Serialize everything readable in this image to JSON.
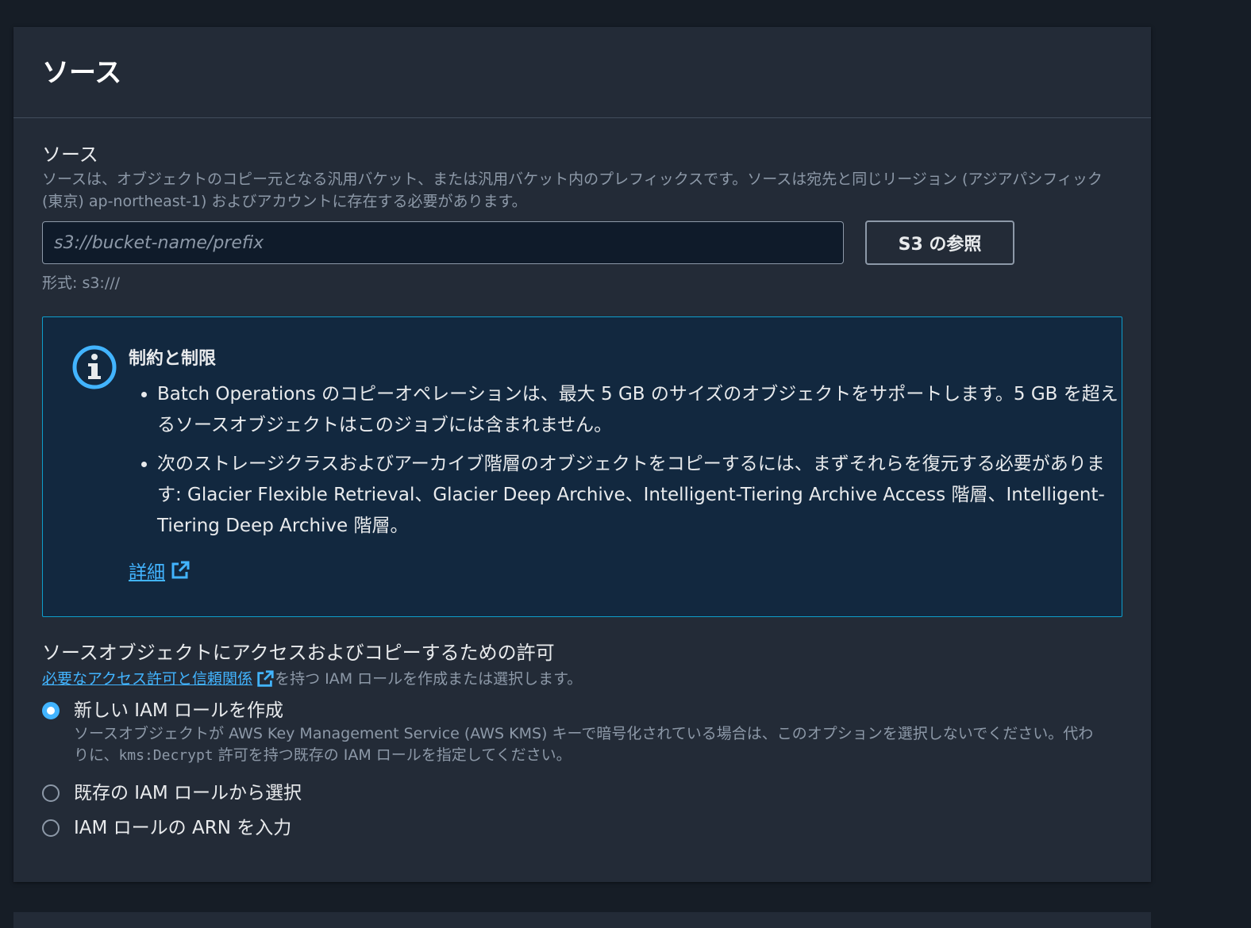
{
  "panel": {
    "title": "ソース"
  },
  "source_field": {
    "label": "ソース",
    "description": "ソースは、オブジェクトのコピー元となる汎用バケット、または汎用バケット内のプレフィックスです。ソースは宛先と同じリージョン (アジアパシフィック (東京) ap-northeast-1) およびアカウントに存在する必要があります。",
    "placeholder": "s3://bucket-name/prefix",
    "value": "",
    "browse_button": "S3 の参照",
    "constraint": "形式: s3:///"
  },
  "alert": {
    "title": "制約と制限",
    "items": [
      "Batch Operations のコピーオペレーションは、最大 5 GB のサイズのオブジェクトをサポートします。5 GB を超えるソースオブジェクトはこのジョブには含まれません。",
      "次のストレージクラスおよびアーカイブ階層のオブジェクトをコピーするには、まずそれらを復元する必要があります: Glacier Flexible Retrieval、Glacier Deep Archive、Intelligent-Tiering Archive Access 階層、Intelligent-Tiering Deep Archive 階層。"
    ],
    "link": "詳細",
    "icon": "info-icon",
    "border_color": "#0e9ecb",
    "bg_color": "#12283f"
  },
  "permissions": {
    "label": "ソースオブジェクトにアクセスおよびコピーするための許可",
    "link": "必要なアクセス許可と信頼関係",
    "desc_suffix": "を持つ IAM ロールを作成または選択します。",
    "options": [
      {
        "label": "新しい IAM ロールを作成",
        "checked": true,
        "desc_before": "ソースオブジェクトが AWS Key Management Service (AWS KMS) キーで暗号化されている場合は、このオプションを選択しないでください。代わりに、",
        "desc_code": "kms:Decrypt",
        "desc_after": " 許可を持つ既存の IAM ロールを指定してください。"
      },
      {
        "label": "既存の IAM ロールから選択",
        "checked": false
      },
      {
        "label": "IAM ロールの ARN を入力",
        "checked": false
      }
    ]
  },
  "colors": {
    "page_bg": "#161d26",
    "panel_bg": "#232b37",
    "accent": "#42b4ff",
    "text": "#e9ebed",
    "muted": "#8d99a8"
  }
}
